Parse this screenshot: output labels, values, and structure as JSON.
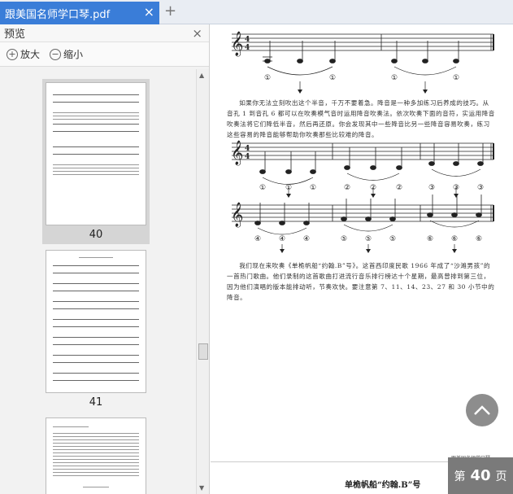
{
  "tab": {
    "title": "跟美国名师学口琴.pdf",
    "close_glyph": "×",
    "add_glyph": "+"
  },
  "sidebar": {
    "title": "预览",
    "close_glyph": "×",
    "zoom_in_label": "放大",
    "zoom_out_label": "缩小",
    "thumbnails": [
      {
        "label": "40",
        "selected": true
      },
      {
        "label": "41",
        "selected": false
      },
      {
        "label": "",
        "selected": false
      }
    ]
  },
  "document": {
    "upper_annotations": [
      "①",
      "①",
      "①",
      "①"
    ],
    "paragraph1": "如果你无法立刻吹出这个半音，千万不要着急。降音是一种多加练习后养成的技巧。从音孔 1 到音孔 6 都可以在吹奏模气音时运用降音吹奏法。依次吹奏下面的音符，实运用降音吹奏法将它们降低半音，然后再还原。你会发现其中一些降音比另一些降音容易吹奏，练习这些容易的降音能够帮助你吹奏那些比较难的降音。",
    "row2_labels": [
      "①",
      "①",
      "①",
      "②",
      "②",
      "②",
      "③",
      "③",
      "③"
    ],
    "row3_labels": [
      "④",
      "④",
      "④",
      "⑤",
      "⑤",
      "⑤",
      "⑥",
      "⑥",
      "⑥"
    ],
    "paragraph2": "我们现在来吹奏《单桅帆船“约翰.B”号》。这首西印度民歌 1966 年成了“沙滩男孩”的一首热门歌曲。他们录制的这首歌曲打进流行音乐排行榜达十个星期，最高曾排到第三位，因为他们演唱的版本能排动听，节奏欢快。要注意第 7、11、14、23、27 和 30 小节中的降音。",
    "running_head": "跟美国名师学口琴",
    "next_title": "单桅帆船“约翰.B”号",
    "page_badge": {
      "prefix": "第",
      "number": "40",
      "suffix": "页"
    }
  }
}
